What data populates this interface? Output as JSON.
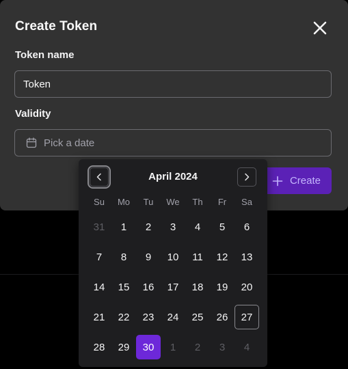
{
  "dialog": {
    "title": "Create Token",
    "close_icon": "close-icon",
    "token_name_label": "Token name",
    "token_name_value": "Token",
    "validity_label": "Validity",
    "date_placeholder": "Pick a date",
    "create_label": "Create"
  },
  "calendar": {
    "month_label": "April 2024",
    "weekdays": [
      "Su",
      "Mo",
      "Tu",
      "We",
      "Th",
      "Fr",
      "Sa"
    ],
    "days": [
      {
        "label": "31",
        "outside": true
      },
      {
        "label": "1"
      },
      {
        "label": "2"
      },
      {
        "label": "3"
      },
      {
        "label": "4"
      },
      {
        "label": "5"
      },
      {
        "label": "6"
      },
      {
        "label": "7"
      },
      {
        "label": "8"
      },
      {
        "label": "9"
      },
      {
        "label": "10"
      },
      {
        "label": "11"
      },
      {
        "label": "12"
      },
      {
        "label": "13"
      },
      {
        "label": "14"
      },
      {
        "label": "15"
      },
      {
        "label": "16"
      },
      {
        "label": "17"
      },
      {
        "label": "18"
      },
      {
        "label": "19"
      },
      {
        "label": "20"
      },
      {
        "label": "21"
      },
      {
        "label": "22"
      },
      {
        "label": "23"
      },
      {
        "label": "24"
      },
      {
        "label": "25"
      },
      {
        "label": "26"
      },
      {
        "label": "27",
        "today": true
      },
      {
        "label": "28"
      },
      {
        "label": "29"
      },
      {
        "label": "30",
        "selected": true
      },
      {
        "label": "1",
        "outside": true
      },
      {
        "label": "2",
        "outside": true
      },
      {
        "label": "3",
        "outside": true
      },
      {
        "label": "4",
        "outside": true
      }
    ]
  },
  "colors": {
    "accent": "#6d28d9",
    "dialog_bg": "#323232",
    "calendar_bg": "#1e1e20",
    "page_bg": "#000000"
  }
}
